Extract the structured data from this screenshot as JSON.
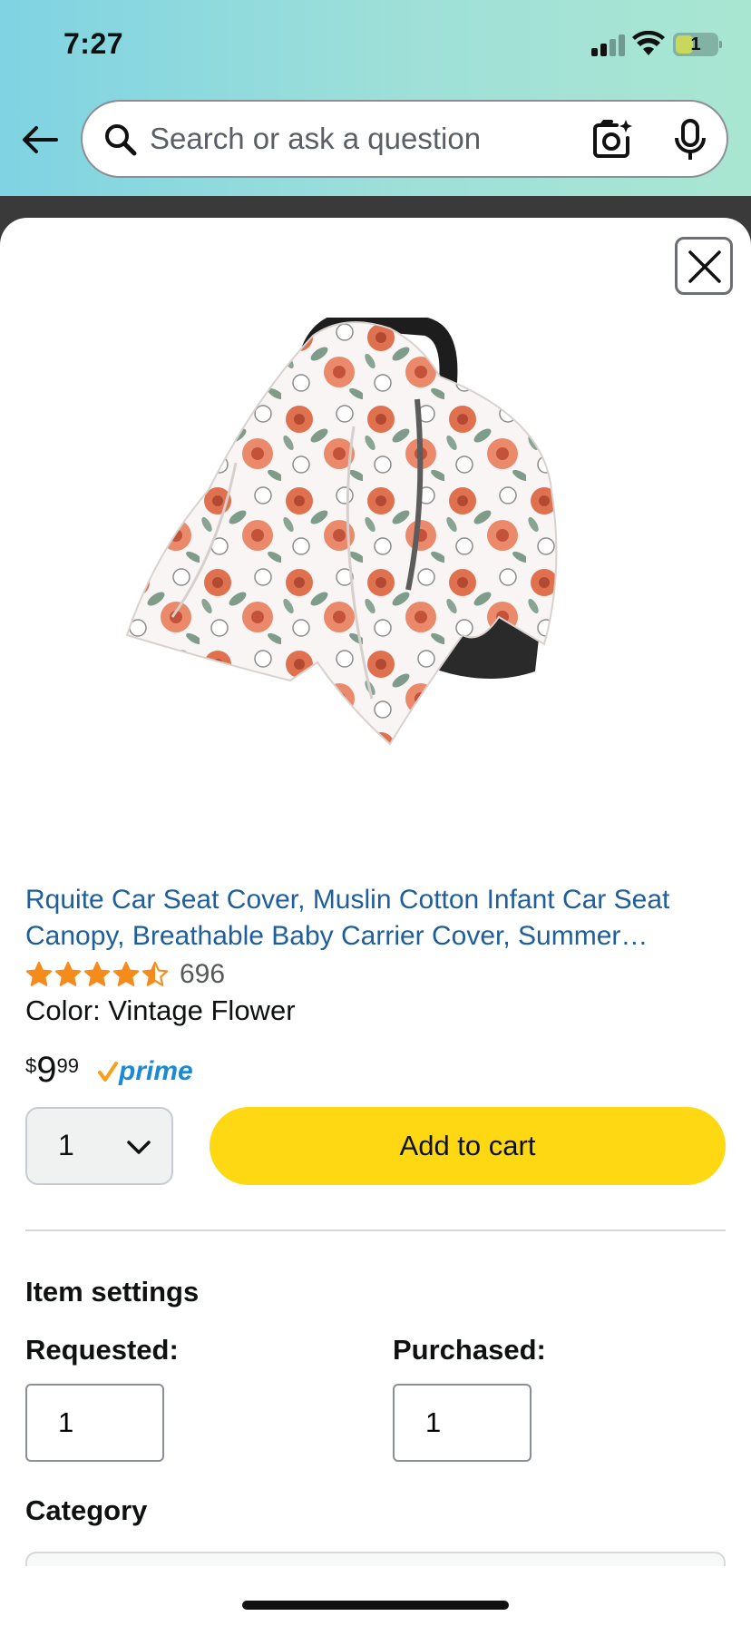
{
  "status_bar": {
    "time": "7:27",
    "battery": "1"
  },
  "search": {
    "placeholder": "Search or ask a question"
  },
  "icons": {
    "back": "arrow-left-icon",
    "search": "magnifier-icon",
    "camera": "camera-lens-icon",
    "mic": "microphone-icon",
    "close": "close-icon",
    "qty_chevron": "chevron-down-icon"
  },
  "product": {
    "title": "Rquite Car Seat Cover, Muslin Cotton Infant Car Seat Canopy, Breathable Baby Carrier Cover, Summer…",
    "rating_value": 4.5,
    "rating_count": "696",
    "color_line": "Color: Vintage Flower",
    "price_symbol": "$",
    "price_whole": "9",
    "price_cents": "99",
    "prime_label": "prime",
    "quantity": "1",
    "add_to_cart_label": "Add to cart"
  },
  "item_settings": {
    "heading": "Item settings",
    "requested_label": "Requested:",
    "requested_value": "1",
    "purchased_label": "Purchased:",
    "purchased_value": "1",
    "category_heading": "Category"
  },
  "colors": {
    "link": "#1f5e9a",
    "star": "#f48b1a",
    "cta": "#ffd814",
    "prime": "#1a8ad6",
    "prime_check": "#f5a11b"
  }
}
